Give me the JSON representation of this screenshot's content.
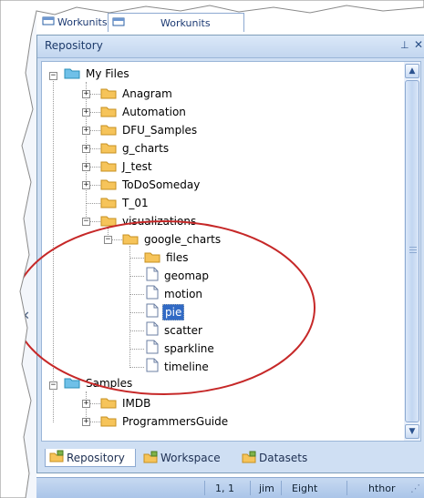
{
  "top_tabs": [
    {
      "label": "Workunits"
    },
    {
      "label": "Workunits"
    }
  ],
  "panel": {
    "title": "Repository",
    "pin_icon": "pin-icon",
    "close_icon": "close-icon"
  },
  "tree": {
    "root": "My Files",
    "folders": [
      "Anagram",
      "Automation",
      "DFU_Samples",
      "g_charts",
      "J_test",
      "ToDoSomeday",
      "T_01",
      "visualizations"
    ],
    "subfolder": "google_charts",
    "leaf_folder": "files",
    "files": [
      "geomap",
      "motion",
      "pie",
      "scatter",
      "sparkline",
      "timeline"
    ],
    "selected": "pie",
    "root2": "Samples",
    "root2_children": [
      "IMDB",
      "ProgrammersGuide"
    ]
  },
  "bottom_tabs": [
    {
      "label": "Repository"
    },
    {
      "label": "Workspace"
    },
    {
      "label": "Datasets"
    }
  ],
  "status": {
    "position": "1, 1",
    "user": "jim",
    "env": "Eight",
    "cluster": "hthor"
  },
  "colors": {
    "accent": "#316ac5",
    "folder": "#f6c45a",
    "annotation_ellipse": "#c62828"
  }
}
